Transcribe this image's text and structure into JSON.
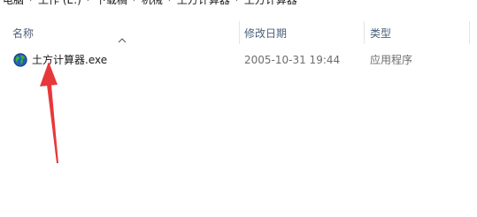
{
  "breadcrumb": {
    "items": [
      "电脑",
      "工作 (E:)",
      "下载稿",
      "机械",
      "土方计算器",
      "土方计算器"
    ]
  },
  "columns": {
    "name": "名称",
    "modified": "修改日期",
    "type": "类型"
  },
  "files": [
    {
      "name": "土方计算器.exe",
      "modified": "2005-10-31 19:44",
      "type": "应用程序",
      "icon": "globe-app-icon"
    }
  ],
  "colors": {
    "header_text": "#4c607a",
    "annotation_arrow": "#e8373a"
  }
}
